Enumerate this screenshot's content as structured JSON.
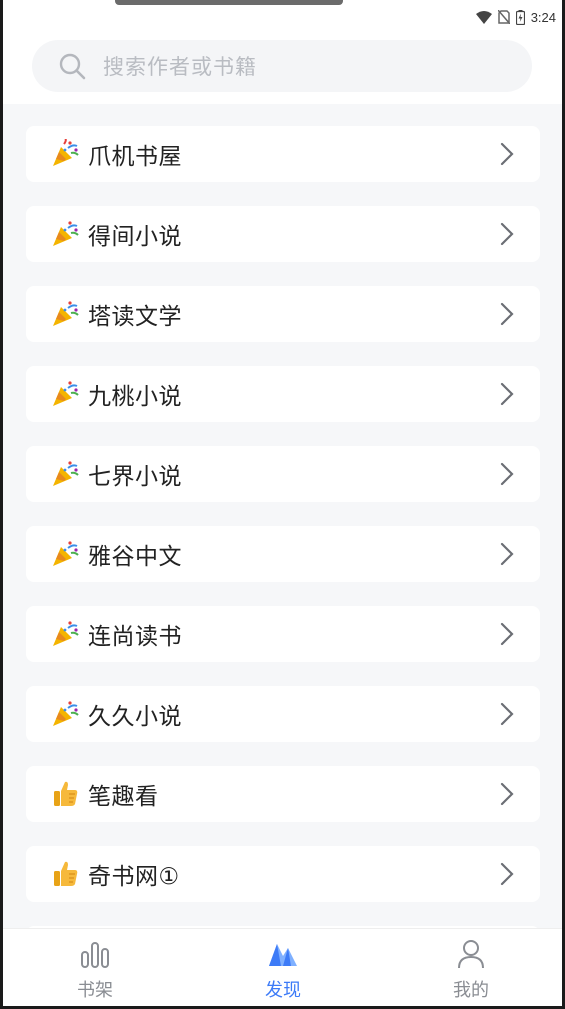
{
  "status_bar": {
    "time": "3:24"
  },
  "search": {
    "placeholder": "搜索作者或书籍",
    "icon": "search-icon"
  },
  "sources": [
    {
      "label": "爪机书屋",
      "icon": "party-popper-icon"
    },
    {
      "label": "得间小说",
      "icon": "party-popper-icon"
    },
    {
      "label": "塔读文学",
      "icon": "party-popper-icon"
    },
    {
      "label": "九桃小说",
      "icon": "party-popper-icon"
    },
    {
      "label": "七界小说",
      "icon": "party-popper-icon"
    },
    {
      "label": "雅谷中文",
      "icon": "party-popper-icon"
    },
    {
      "label": "连尚读书",
      "icon": "party-popper-icon"
    },
    {
      "label": "久久小说",
      "icon": "party-popper-icon"
    },
    {
      "label": "笔趣看",
      "icon": "thumbs-up-icon"
    },
    {
      "label": "奇书网①",
      "icon": "thumbs-up-icon"
    }
  ],
  "tabs": [
    {
      "label": "书架",
      "icon": "bookshelf-icon",
      "active": false
    },
    {
      "label": "发现",
      "icon": "discover-icon",
      "active": true
    },
    {
      "label": "我的",
      "icon": "person-icon",
      "active": false
    }
  ],
  "colors": {
    "accent": "#3d7bf7",
    "inactive": "#8a8d93",
    "background": "#f6f7f9"
  }
}
